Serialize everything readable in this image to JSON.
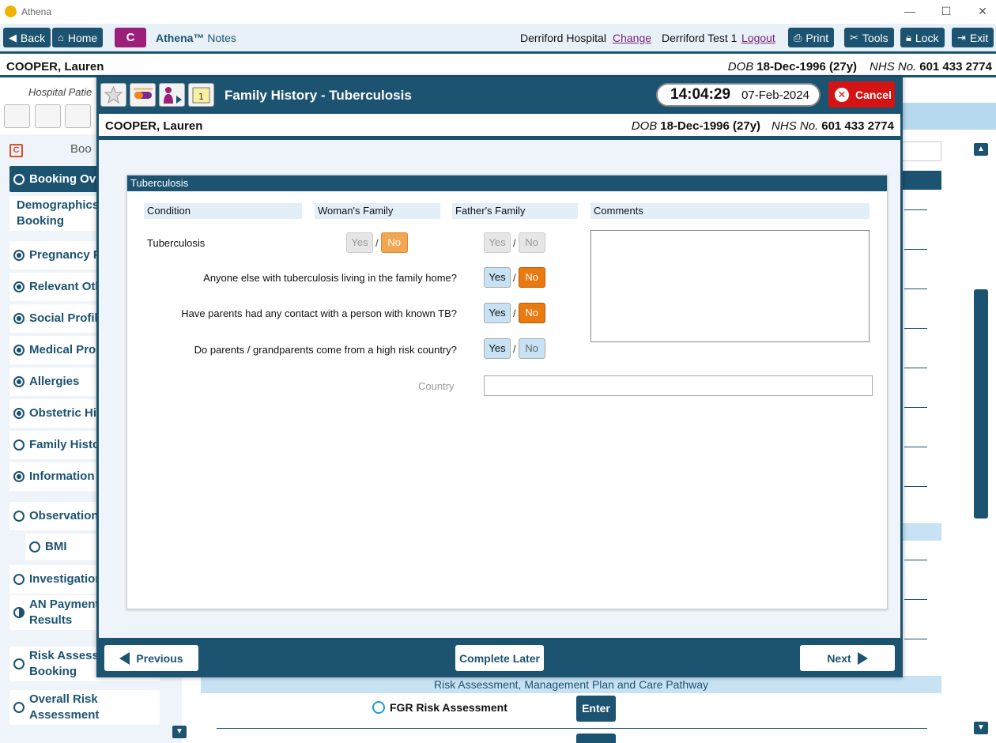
{
  "app": {
    "title": "Athena"
  },
  "toolbar": {
    "back": "Back",
    "home": "Home",
    "brand_letter": "C",
    "brand_name": "Athena™",
    "brand_suffix": "Notes",
    "hospital": "Derriford Hospital",
    "change": "Change",
    "user": "Derriford Test 1",
    "logout": "Logout",
    "print": "Print",
    "tools": "Tools",
    "lock": "Lock",
    "exit": "Exit"
  },
  "patient": {
    "name": "COOPER, Lauren",
    "dob_label": "DOB",
    "dob": "18-Dec-1996 (27y)",
    "nhs_label": "NHS No.",
    "nhs": "601 433 2774"
  },
  "background": {
    "hospital_label": "Hospital Patie",
    "sidebar_header": "Boo",
    "active_item": "Booking Ov",
    "sidebar_items": [
      {
        "label": "Demographics Booking",
        "radio": "none"
      },
      {
        "label": "Pregnancy P",
        "radio": "full"
      },
      {
        "label": "Relevant Oth",
        "radio": "full"
      },
      {
        "label": "Social Profil",
        "radio": "full"
      },
      {
        "label": "Medical Pro",
        "radio": "full"
      },
      {
        "label": "Allergies",
        "radio": "full"
      },
      {
        "label": "Obstetric Hi",
        "radio": "full"
      },
      {
        "label": "Family Histo",
        "radio": "empty"
      },
      {
        "label": "Information",
        "radio": "full"
      },
      {
        "label": "Observation",
        "radio": "empty"
      },
      {
        "label": "BMI",
        "radio": "empty"
      },
      {
        "label": "Investigation",
        "radio": "empty"
      },
      {
        "label": "AN Payment Results",
        "radio": "half"
      },
      {
        "label": "Risk Assess Booking",
        "radio": "empty"
      },
      {
        "label": "Overall Risk Assessment",
        "radio": "empty"
      }
    ],
    "risk_section": "Risk Assessment, Management Plan and Care Pathway",
    "fgr_label": "FGR Risk Assessment",
    "enter": "Enter"
  },
  "modal": {
    "title": "Family History - Tuberculosis",
    "time": "14:04:29",
    "date": "07-Feb-2024",
    "cancel": "Cancel",
    "panel_title": "Tuberculosis",
    "columns": {
      "condition": "Condition",
      "woman": "Woman's Family",
      "father": "Father's Family",
      "comments": "Comments"
    },
    "yes": "Yes",
    "no": "No",
    "sep": "/",
    "rows": {
      "tb": "Tuberculosis",
      "q1": "Anyone else with tuberculosis living in the family home?",
      "q2": "Have parents had any contact with a person with known TB?",
      "q3": "Do parents / grandparents come from a high risk country?"
    },
    "country_label": "Country",
    "country_value": "",
    "comments_value": "",
    "previous": "Previous",
    "complete_later": "Complete Later",
    "next": "Next"
  }
}
